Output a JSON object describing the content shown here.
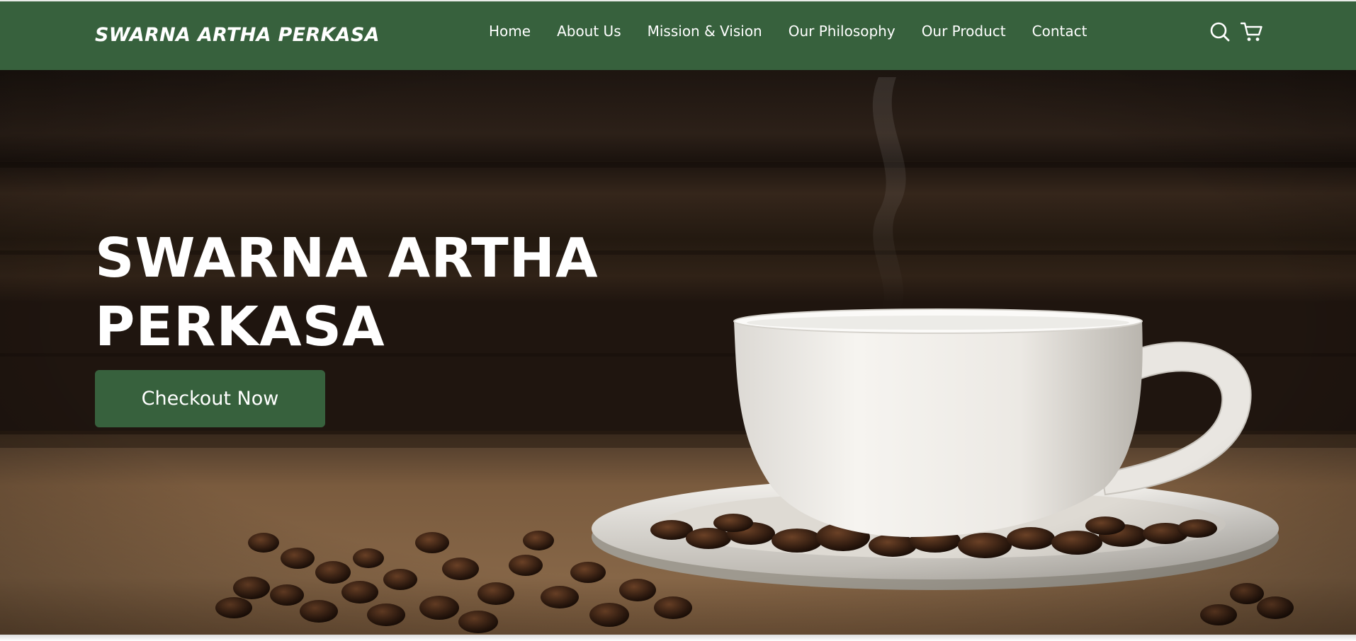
{
  "brand": {
    "name": "SWARNA ARTHA PERKASA"
  },
  "nav": {
    "links": [
      {
        "label": "Home"
      },
      {
        "label": "About Us"
      },
      {
        "label": "Mission & Vision"
      },
      {
        "label": "Our Philosophy"
      },
      {
        "label": "Our Product"
      },
      {
        "label": "Contact"
      }
    ],
    "icons": [
      "search-icon",
      "cart-icon"
    ]
  },
  "hero": {
    "title_line1": "SWARNA ARTHA",
    "title_line2": "PERKASA",
    "cta_label": "Checkout Now",
    "image_subject": "white coffee cup on saucer with roasted coffee beans on burlap"
  },
  "colors": {
    "brand_green": "#37613d",
    "text_white": "#ffffff",
    "wood_dark": "#2b1e16",
    "burlap": "#7a5a3c"
  }
}
